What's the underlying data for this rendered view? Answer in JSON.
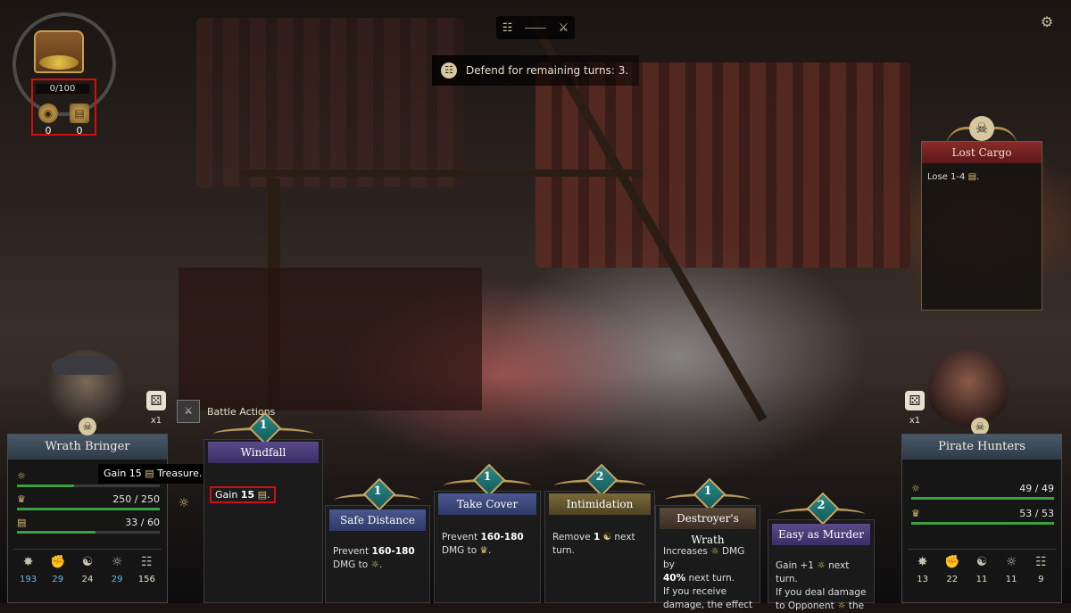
{
  "top_bar": {
    "left_icon": "scroll-icon",
    "right_icon": "crossed-swords-icon"
  },
  "objective": {
    "text": "Defend for remaining turns: 3.",
    "icon": "scroll-icon"
  },
  "settings_icon": "gear-icon",
  "treasure": {
    "capacity": "0/100",
    "resources": [
      {
        "icon": "coin-icon",
        "value": "0"
      },
      {
        "icon": "cargo-icon",
        "value": "0"
      }
    ]
  },
  "enemy_card": {
    "title": "Lost Cargo",
    "text": "Lose 1-4",
    "text_suffix": "."
  },
  "player": {
    "dice_count": "x1",
    "name": "Wrath Bringer",
    "bars": [
      {
        "icon": "sun-icon",
        "value": "",
        "fill": 0.4
      },
      {
        "icon": "health-icon",
        "value": "250 / 250",
        "fill": 1.0
      },
      {
        "icon": "treasure-icon",
        "value": "33 / 60",
        "fill": 0.55
      }
    ],
    "stats": [
      "193",
      "29",
      "24",
      "29",
      "156"
    ]
  },
  "battle_actions": {
    "label": "Battle Actions"
  },
  "tooltip": {
    "text": "Gain 15",
    "suffix": "Treasure."
  },
  "opponent": {
    "dice_count": "x1",
    "name": "Pirate Hunters",
    "bars": [
      {
        "icon": "sun-icon",
        "value": "49 / 49",
        "fill": 1.0
      },
      {
        "icon": "health-icon",
        "value": "53 / 53",
        "fill": 1.0
      }
    ],
    "stats": [
      "13",
      "22",
      "11",
      "11",
      "9"
    ]
  },
  "cards": [
    {
      "cost": "1",
      "title": "Windfall",
      "body_prefix": "Gain",
      "body_bold": "15",
      "body_suffix": "."
    },
    {
      "cost": "1",
      "title": "Safe Distance",
      "body_l1": "Prevent",
      "body_bold": "160-180",
      "body_l2": "DMG to"
    },
    {
      "cost": "1",
      "title": "Take Cover",
      "body_l1": "Prevent",
      "body_bold": "160-180",
      "body_l2": "DMG to"
    },
    {
      "cost": "2",
      "title": "Intimidation",
      "body_l1": "Remove",
      "body_bold": "1",
      "body_l2": "next",
      "body_l3": "turn."
    },
    {
      "cost": "1",
      "title": "Destroyer's Wrath",
      "body_l1": "Increases",
      "body_l1b": "DMG by",
      "body_bold": "40%",
      "body_l2": "next turn.",
      "body_l3": "If you receive",
      "body_l4": "damage, the effect"
    },
    {
      "cost": "2",
      "title": "Easy as Murder",
      "body_l1": "Gain +1",
      "body_l1b": "next turn.",
      "body_l2": "If you deal damage",
      "body_l3": "to Opponent",
      "body_l3b": "the"
    }
  ],
  "colors": {
    "health_bar": "#3aa040",
    "highlight_box": "#d01010",
    "cost_gem": "#2a8a8a"
  }
}
